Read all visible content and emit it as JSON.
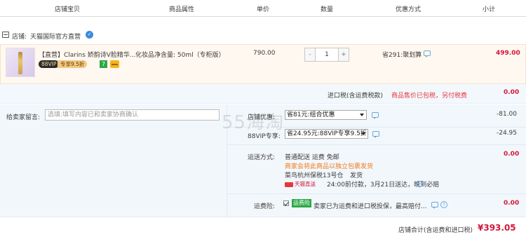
{
  "header": {
    "columns": [
      "店铺宝贝",
      "商品属性",
      "单价",
      "数量",
      "优惠方式",
      "小计"
    ]
  },
  "shop": {
    "prefix": "店铺:",
    "name": "天猫国际官方直营",
    "badge_icon": "info-badge"
  },
  "item": {
    "title": "【直营】Clarins 娇韵诗V脸精华...",
    "attribute": "化妆品净含量: 50ml（专柜版）",
    "vip_label": "88VIP",
    "vip_discount": "专享9.5折",
    "unit_price": "790.00",
    "quantity": "1",
    "minus_label": "-",
    "plus_label": "+",
    "discount_method": "省291:聚划算",
    "subtotal": "499.00",
    "icon_seven": "7"
  },
  "tax": {
    "label": "进口税(含运费税款)",
    "note": "商品售价已包税，另付税费",
    "amount": "0.00"
  },
  "message": {
    "label": "给卖家留言:",
    "placeholder": "选填:填写内容已和卖家协商确认"
  },
  "shop_discount": {
    "label": "店铺优惠:",
    "selected": "省81元:组合优惠",
    "amount": "-81.00"
  },
  "vip_discount": {
    "label": "88VIP专享:",
    "selected": "省24.95元:88VIP专享9.5折",
    "amount": "-24.95"
  },
  "shipping": {
    "label": "运送方式:",
    "method": "普通配送 运费 免邮",
    "notice": "商家会将此商品以独立包裹发货",
    "warehouse": "菜鸟杭州保税13号仓",
    "dispatch": "发货",
    "logo_text": "天猫直送",
    "eta": "24:00前付款，3月21日送达，晚到必赔",
    "amount": "0.00"
  },
  "insurance": {
    "label": "运费险:",
    "tag": "运费险",
    "text": "卖家已为运费和进口税投保，最高赔付...",
    "amount": "0.00"
  },
  "total": {
    "label": "店铺合计(含运费和进口税)",
    "amount": "¥393.05"
  },
  "watermark": "55海淘",
  "colors": {
    "price_red": "#d4153a",
    "accent_blue": "#3c8bde",
    "notice_orange": "#ef7b1a",
    "tag_green": "#2ba845"
  }
}
